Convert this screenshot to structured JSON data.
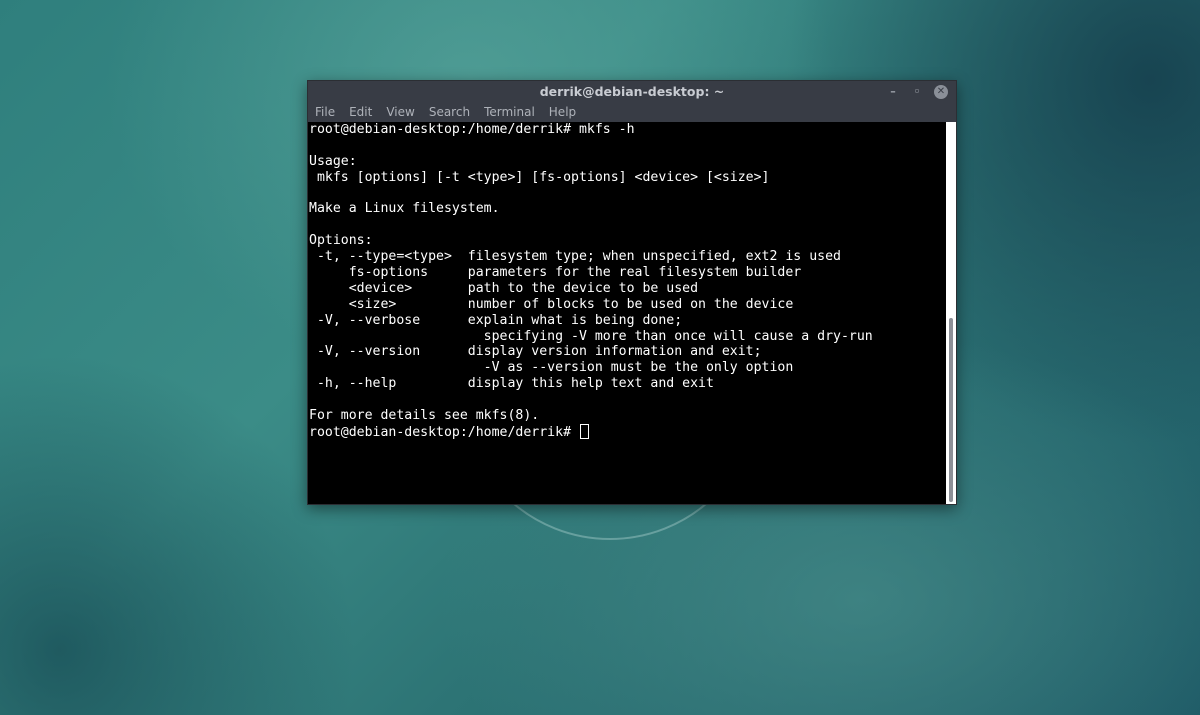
{
  "window": {
    "title": "derrik@debian-desktop: ~",
    "controls": {
      "minimize": "–",
      "maximize": "◦",
      "close": "✕"
    }
  },
  "menubar": {
    "items": [
      "File",
      "Edit",
      "View",
      "Search",
      "Terminal",
      "Help"
    ]
  },
  "terminal": {
    "lines": [
      "root@debian-desktop:/home/derrik# mkfs -h",
      "",
      "Usage:",
      " mkfs [options] [-t <type>] [fs-options] <device> [<size>]",
      "",
      "Make a Linux filesystem.",
      "",
      "Options:",
      " -t, --type=<type>  filesystem type; when unspecified, ext2 is used",
      "     fs-options     parameters for the real filesystem builder",
      "     <device>       path to the device to be used",
      "     <size>         number of blocks to be used on the device",
      " -V, --verbose      explain what is being done;",
      "                      specifying -V more than once will cause a dry-run",
      " -V, --version      display version information and exit;",
      "                      -V as --version must be the only option",
      " -h, --help         display this help text and exit",
      "",
      "For more details see mkfs(8)."
    ],
    "prompt": "root@debian-desktop:/home/derrik# "
  },
  "colors": {
    "titlebar": "#383c45",
    "terminal_bg": "#000000",
    "terminal_fg": "#ffffff"
  }
}
